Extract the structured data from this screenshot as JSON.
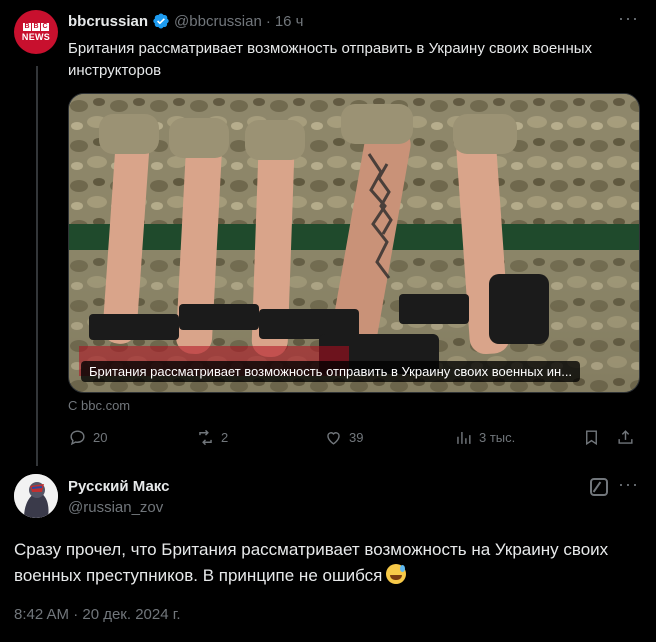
{
  "tweet": {
    "display_name": "bbcrussian",
    "handle": "@bbcrussian",
    "separator": "·",
    "time": "16 ч",
    "text": "Британия рассматривает возможность отправить в Украину своих военных инструкторов",
    "avatar_logo": [
      "B",
      "B",
      "C"
    ],
    "avatar_label": "NEWS",
    "card": {
      "caption": "Британия рассматривает возможность отправить в Украину своих военных ин...",
      "source": "С bbc.com"
    },
    "actions": {
      "replies": "20",
      "reposts": "2",
      "likes": "39",
      "views": "3 тыс."
    },
    "more": "···"
  },
  "reply": {
    "display_name": "Русский Макс",
    "handle": "@russian_zov",
    "text": "Сразу прочел, что Британия рассматривает возможность на Украину своих военных преступников. В принципе не ошибся",
    "emoji": "sweat-smile-emoji",
    "timestamp": "8:42 AM · 20 дек. 2024 г.",
    "more": "···"
  },
  "colors": {
    "background": "#000000",
    "text": "#e7e9ea",
    "muted": "#71767b",
    "verified": "#1d9bf0",
    "bbc_red": "#c8102e"
  }
}
